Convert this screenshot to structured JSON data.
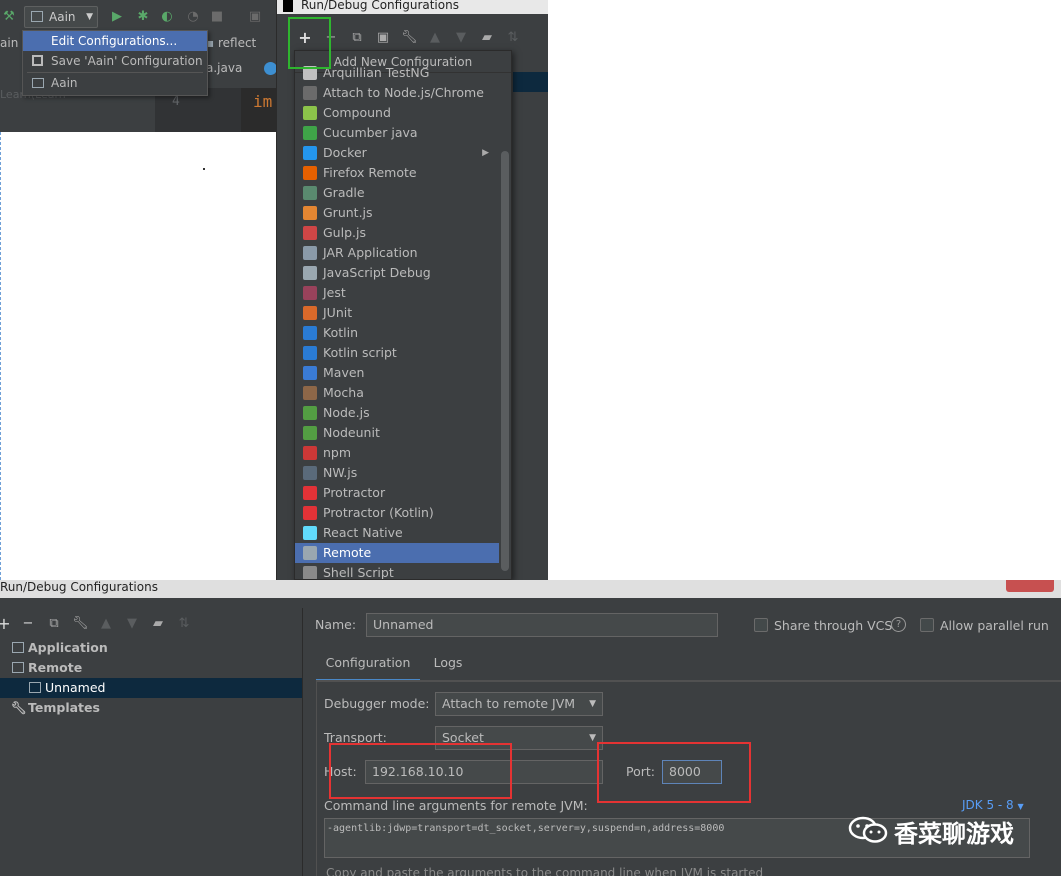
{
  "ide_top": {
    "run_config_name": "Aain",
    "left_label": "ain",
    "faded_text": "Learn(Learn",
    "breadcrumb": "reflect",
    "tab_file": "a.java",
    "editor_line_number": "4",
    "editor_code": "im",
    "config_menu": {
      "items": [
        {
          "label": "Edit Configurations...",
          "selected": true
        },
        {
          "label": "Save 'Aain' Configuration",
          "selected": false
        },
        {
          "label": "Aain",
          "selected": false
        }
      ]
    }
  },
  "dialog_add": {
    "title": "Run/Debug Configurations",
    "popup_title": "Add New Configuration",
    "items": [
      {
        "label": "Arquillian TestNG",
        "icon": "arquillian-icon",
        "color": "#c0c0c0"
      },
      {
        "label": "Attach to Node.js/Chrome",
        "icon": "attach-nodejs-icon",
        "color": "#6b6b6b"
      },
      {
        "label": "Compound",
        "icon": "compound-icon",
        "color": "#8bc34a"
      },
      {
        "label": "Cucumber java",
        "icon": "cucumber-icon",
        "color": "#3fa348"
      },
      {
        "label": "Docker",
        "icon": "docker-icon",
        "color": "#2496ed",
        "submenu": true
      },
      {
        "label": "Firefox Remote",
        "icon": "firefox-icon",
        "color": "#e66000"
      },
      {
        "label": "Gradle",
        "icon": "gradle-icon",
        "color": "#5a8a6f"
      },
      {
        "label": "Grunt.js",
        "icon": "grunt-icon",
        "color": "#e48632"
      },
      {
        "label": "Gulp.js",
        "icon": "gulp-icon",
        "color": "#cf4646"
      },
      {
        "label": "JAR Application",
        "icon": "jar-icon",
        "color": "#8a9aa8"
      },
      {
        "label": "JavaScript Debug",
        "icon": "js-debug-icon",
        "color": "#9aa7b0"
      },
      {
        "label": "Jest",
        "icon": "jest-icon",
        "color": "#99425b"
      },
      {
        "label": "JUnit",
        "icon": "junit-icon",
        "color": "#d9692a"
      },
      {
        "label": "Kotlin",
        "icon": "kotlin-icon",
        "color": "#2a7bd4"
      },
      {
        "label": "Kotlin script",
        "icon": "kotlin-script-icon",
        "color": "#2a7bd4"
      },
      {
        "label": "Maven",
        "icon": "maven-icon",
        "color": "#3a7bd5"
      },
      {
        "label": "Mocha",
        "icon": "mocha-icon",
        "color": "#8d6748"
      },
      {
        "label": "Node.js",
        "icon": "nodejs-icon",
        "color": "#539e43"
      },
      {
        "label": "Nodeunit",
        "icon": "nodeunit-icon",
        "color": "#539e43"
      },
      {
        "label": "npm",
        "icon": "npm-icon",
        "color": "#cb3837"
      },
      {
        "label": "NW.js",
        "icon": "nwjs-icon",
        "color": "#5a6a7a"
      },
      {
        "label": "Protractor",
        "icon": "protractor-icon",
        "color": "#e23237"
      },
      {
        "label": "Protractor (Kotlin)",
        "icon": "protractor-kotlin-icon",
        "color": "#e23237"
      },
      {
        "label": "React Native",
        "icon": "react-icon",
        "color": "#61dafb"
      },
      {
        "label": "Remote",
        "icon": "remote-icon",
        "color": "#9aa7b0",
        "selected": true
      },
      {
        "label": "Shell Script",
        "icon": "shell-icon",
        "color": "#8a8a8a"
      }
    ]
  },
  "dialog_config": {
    "title": "Run/Debug Configurations",
    "tree": [
      {
        "label": "Application",
        "bold": true,
        "indent": 0
      },
      {
        "label": "Remote",
        "bold": true,
        "indent": 0
      },
      {
        "label": "Unnamed",
        "bold": false,
        "indent": 1,
        "selected": true
      },
      {
        "label": "Templates",
        "bold": true,
        "indent": 0
      }
    ],
    "name_label": "Name:",
    "name_value": "Unnamed",
    "share_vcs_label": "Share through VCS",
    "allow_parallel_label": "Allow parallel run",
    "help_glyph": "?",
    "tab_configuration": "Configuration",
    "tab_logs": "Logs",
    "debugger_mode_label": "Debugger mode:",
    "debugger_mode_value": "Attach to remote JVM",
    "transport_label": "Transport:",
    "transport_value": "Socket",
    "host_label": "Host:",
    "host_value": "192.168.10.10",
    "port_label": "Port:",
    "port_value": "8000",
    "args_label": "Command line arguments for remote JVM:",
    "jdk_link": "JDK 5 - 8",
    "args_value": "-agentlib:jdwp=transport=dt_socket,server=y,suspend=n,address=8000",
    "hint": "Copy and paste the arguments to the command line when JVM is started"
  },
  "watermark": "香菜聊游戏",
  "colors": {
    "highlight_green": "#2fb52f",
    "highlight_red": "#e53333",
    "selection_blue": "#4b6eaf"
  }
}
